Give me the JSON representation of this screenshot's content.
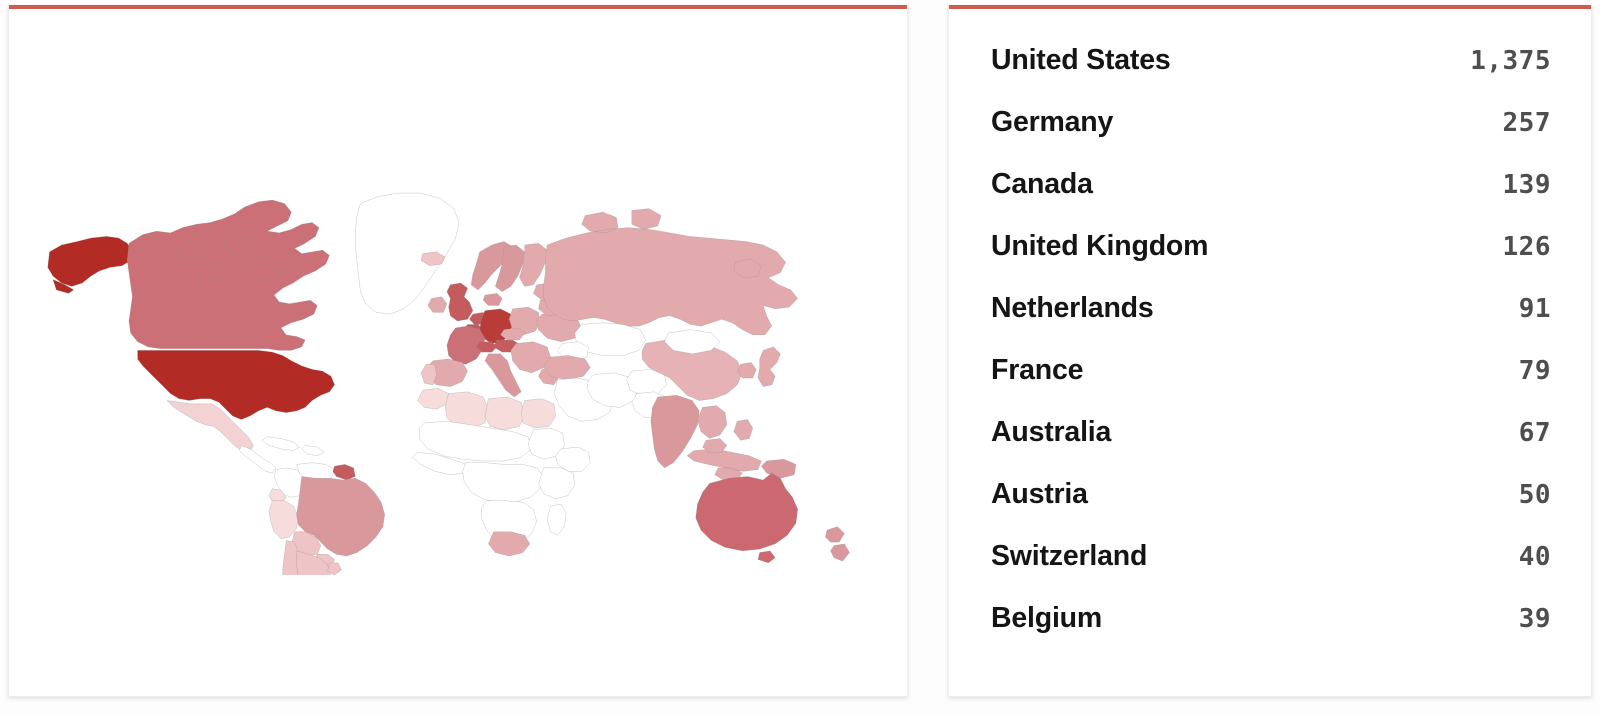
{
  "theme": {
    "accent_bar_color": "#cf5b4e",
    "card_background": "#ffffff",
    "page_background": "#fdfdfd",
    "name_text_color": "#151515",
    "value_text_color": "#4e4e4e",
    "map_border_color": "#8e8e8e",
    "map_no_data_color": "#ffffff"
  },
  "map_panel": {
    "title": "",
    "choropleth_scale": [
      "#f7dcdc",
      "#eec4c6",
      "#e2aaad",
      "#d9999c",
      "#cc7077",
      "#c45c5f",
      "#b22b24"
    ]
  },
  "list_panel": {
    "rows": [
      {
        "country": "United States",
        "value": "1,375"
      },
      {
        "country": "Germany",
        "value": "257"
      },
      {
        "country": "Canada",
        "value": "139"
      },
      {
        "country": "United Kingdom",
        "value": "126"
      },
      {
        "country": "Netherlands",
        "value": "91"
      },
      {
        "country": "France",
        "value": "79"
      },
      {
        "country": "Australia",
        "value": "67"
      },
      {
        "country": "Austria",
        "value": "50"
      },
      {
        "country": "Switzerland",
        "value": "40"
      },
      {
        "country": "Belgium",
        "value": "39"
      }
    ]
  },
  "chart_data": {
    "type": "map",
    "title": "",
    "subtype": "choropleth",
    "value_label": "count",
    "categories": [
      "United States",
      "Germany",
      "Canada",
      "United Kingdom",
      "Netherlands",
      "France",
      "Australia",
      "Austria",
      "Switzerland",
      "Belgium"
    ],
    "values": [
      1375,
      257,
      139,
      126,
      91,
      79,
      67,
      50,
      40,
      39
    ],
    "legend": "none",
    "grid": false,
    "map_fills": {
      "United States": "#b22b24",
      "Germany": "#b93c39",
      "Canada": "#cc7077",
      "United Kingdom": "#c45c5f",
      "Netherlands": "#c45c5f",
      "France": "#cc7077",
      "Australia": "#cc6870",
      "Austria": "#c45c5f",
      "Switzerland": "#c45c5f",
      "Belgium": "#c45c5f",
      "Russia": "#e2aaad",
      "China": "#e6b2b5",
      "India": "#d9999c",
      "Brazil": "#d9999c",
      "Japan": "#e2aaad",
      "Spain": "#e2aaad",
      "Italy": "#d9999c",
      "Sweden": "#d9999c",
      "Norway": "#d9999c",
      "Poland": "#e2aaad",
      "Argentina": "#eec4c6",
      "Chile": "#eec4c6",
      "South Africa": "#e2aaad",
      "Mexico": "#f2d2d3",
      "Egypt": "#f7dcdc",
      "Turkey": "#e2aaad",
      "Indonesia": "#e2aaad",
      "New Zealand": "#d9999c",
      "Greenland": "#ffffff"
    }
  }
}
